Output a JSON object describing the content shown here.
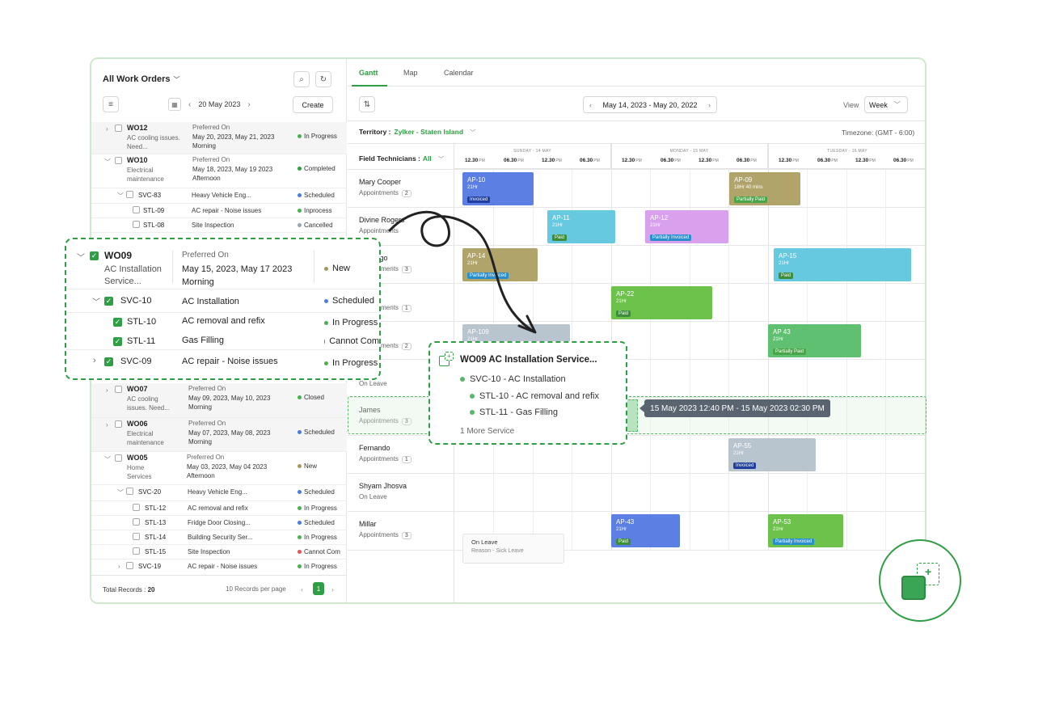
{
  "left_panel": {
    "title": "All Work Orders",
    "date": "20 May 2023",
    "create_label": "Create",
    "rows": [
      {
        "code": "WO12",
        "desc": "AC cooling issues. Need...",
        "pref": "Preferred On",
        "dates": "May 20, 2023, May 21, 2023",
        "slot": "Morning",
        "status": "In Progress"
      },
      {
        "code": "WO10",
        "desc": "Electrical maintenance",
        "pref": "Preferred On",
        "dates": "May 18, 2023, May 19 2023",
        "slot": "Afternoon",
        "status": "Completed"
      },
      {
        "code": "SVC-83",
        "name": "Heavy Vehicle Eng...",
        "status": "Scheduled"
      },
      {
        "code": "STL-09",
        "name": "AC repair - Noise issues",
        "status": "Inprocess"
      },
      {
        "code": "STL-08",
        "name": "Site Inspection",
        "status": "Cancelled"
      },
      {
        "code": "WO07",
        "desc": "AC cooling issues. Need...",
        "pref": "Preferred On",
        "dates": "May 09, 2023, May 10, 2023",
        "slot": "Morning",
        "status": "Closed"
      },
      {
        "code": "WO06",
        "desc": "Electrical maintenance",
        "pref": "Preferred On",
        "dates": "May 07, 2023, May 08, 2023",
        "slot": "Morning",
        "status": "Scheduled"
      },
      {
        "code": "WO05",
        "desc": "Home Services",
        "pref": "Preferred On",
        "dates": "May 03, 2023, May 04 2023",
        "slot": "Afternoon",
        "status": "New"
      },
      {
        "code": "SVC-20",
        "name": "Heavy Vehicle Eng...",
        "status": "Scheduled"
      },
      {
        "code": "STL-12",
        "name": "AC removal and refix",
        "status": "In Progress"
      },
      {
        "code": "STL-13",
        "name": "Fridge Door Closing...",
        "status": "Scheduled"
      },
      {
        "code": "STL-14",
        "name": "Building Security Ser...",
        "status": "In Progress"
      },
      {
        "code": "STL-15",
        "name": "Site Inspection",
        "status": "Cannot Com"
      },
      {
        "code": "SVC-19",
        "name": "AC repair - Noise issues",
        "status": "In Progress"
      }
    ],
    "footer": {
      "total_label": "Total Records :",
      "total": "20",
      "per_page": "10 Records per page",
      "page": "1"
    }
  },
  "tabs": [
    "Gantt",
    "Map",
    "Calendar"
  ],
  "toolbar": {
    "range": "May 14, 2023 - May 20, 2022",
    "view_label": "View",
    "view_value": "Week"
  },
  "territory": {
    "label": "Territory :",
    "value": "Zylker - Staten Island"
  },
  "timezone": "Timezone: (GMT - 6:00)",
  "field_tech": {
    "label": "Field Technicians :",
    "value": "All"
  },
  "days": [
    "SUNDAY - 14 MAY",
    "MONDAY - 15 MAY",
    "TUESDAY - 16 MAY"
  ],
  "time_labels": [
    "12.30",
    "06.30",
    "12.30",
    "06.30"
  ],
  "pm": "PM",
  "technicians": [
    {
      "name": "Mary Cooper",
      "sub": "Appointments",
      "count": "2"
    },
    {
      "name": "Divine Rogers",
      "sub": "Appointments",
      "count": ""
    },
    {
      "name": "Santiago",
      "sub": "Appointments",
      "count": "3"
    },
    {
      "name": "",
      "sub": "Appointments",
      "count": "1"
    },
    {
      "name": "",
      "sub": "Appointments",
      "count": "2"
    },
    {
      "name": "",
      "sub": "On Leave",
      "count": ""
    },
    {
      "name": "James",
      "sub": "Appointments",
      "count": "3"
    },
    {
      "name": "Fernando",
      "sub": "Appointments",
      "count": "1"
    },
    {
      "name": "Shyam Jhosva",
      "sub": "On Leave",
      "count": ""
    },
    {
      "name": "Millar",
      "sub": "Appointments",
      "count": "3"
    }
  ],
  "appointments": [
    {
      "id": "AP-10",
      "hr": "21Hr",
      "tag": "Invoiced"
    },
    {
      "id": "AP-09",
      "hr": "18Hr 40 mins",
      "tag": "Partially Paid"
    },
    {
      "id": "AP-11",
      "hr": "21Hr",
      "tag": "Paid"
    },
    {
      "id": "AP-12",
      "hr": "21Hr",
      "tag": "Partially Invoiced"
    },
    {
      "id": "AP-14",
      "hr": "21Hr",
      "tag": "Partially Invoiced"
    },
    {
      "id": "AP-15",
      "hr": "21Hr",
      "tag": "Paid"
    },
    {
      "id": "AP-22",
      "hr": "21Hr",
      "tag": "Paid"
    },
    {
      "id": "AP-109",
      "hr": "21Hr",
      "tag": ""
    },
    {
      "id": "AP 43",
      "hr": "21Hr",
      "tag": "Partially Paid"
    },
    {
      "id": "AP-55",
      "hr": "21Hr",
      "tag": "Invoiced"
    },
    {
      "id": "AP-43",
      "hr": "21Hr",
      "tag": "Paid"
    },
    {
      "id": "AP-53",
      "hr": "21Hr",
      "tag": "Partially Invoiced"
    }
  ],
  "leave_box": {
    "title": "On Leave",
    "reason": "Reason - Sick Leave"
  },
  "wo_card": {
    "code": "WO09",
    "desc": "AC Installation Service...",
    "pref": "Preferred On",
    "dates": "May 15, 2023, May 17 2023",
    "slot": "Morning",
    "status": "New",
    "items": [
      {
        "code": "SVC-10",
        "name": "AC Installation",
        "status": "Scheduled"
      },
      {
        "code": "STL-10",
        "name": "AC removal and refix",
        "status": "In Progress"
      },
      {
        "code": "STL-11",
        "name": "Gas Filling",
        "status": "Cannot Com"
      },
      {
        "code": "SVC-09",
        "name": "AC repair - Noise issues",
        "status": "In Progress"
      }
    ]
  },
  "popup": {
    "title": "WO09 AC Installation Service...",
    "items": [
      "SVC-10 - AC Installation",
      "STL-10 - AC removal and refix",
      "STL-11 - Gas Filling"
    ],
    "more": "1 More Service"
  },
  "tooltip": "15 May 2023 12:40 PM - 15 May 2023 02:30 PM",
  "colors": {
    "accent": "#2f9e44",
    "in_progress": "#4caf50",
    "completed": "#2e9e44",
    "scheduled": "#4a7de0",
    "cancelled": "#9aa5b1",
    "new": "#a59a5c",
    "cannot": "#e05555"
  }
}
